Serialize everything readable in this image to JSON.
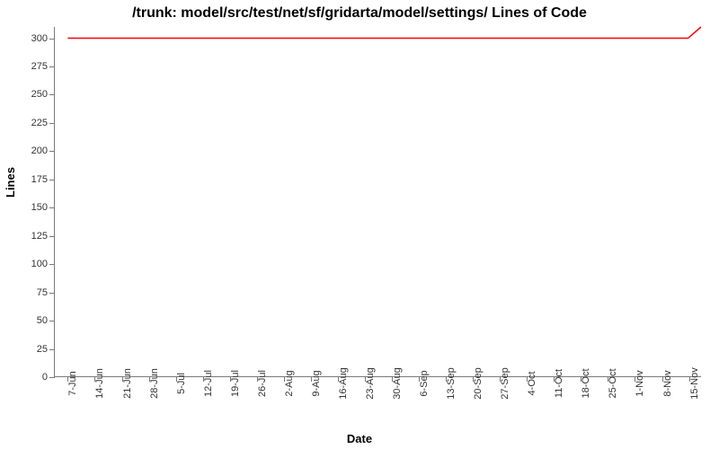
{
  "chart_data": {
    "type": "line",
    "title": "/trunk: model/src/test/net/sf/gridarta/model/settings/ Lines of Code",
    "xlabel": "Date",
    "ylabel": "Lines",
    "ylim": [
      0,
      310
    ],
    "y_ticks": [
      0,
      25,
      50,
      75,
      100,
      125,
      150,
      175,
      200,
      225,
      250,
      275,
      300
    ],
    "x_ticks": [
      "7-Jun",
      "14-Jun",
      "21-Jun",
      "28-Jun",
      "5-Jul",
      "12-Jul",
      "19-Jul",
      "26-Jul",
      "2-Aug",
      "9-Aug",
      "16-Aug",
      "23-Aug",
      "30-Aug",
      "6-Sep",
      "13-Sep",
      "20-Sep",
      "27-Sep",
      "4-Oct",
      "11-Oct",
      "18-Oct",
      "25-Oct",
      "1-Nov",
      "8-Nov",
      "15-Nov"
    ],
    "series": [
      {
        "name": "Lines of Code",
        "color": "#ff0000",
        "points": [
          {
            "x": "7-Jun",
            "y": 300
          },
          {
            "x": "14-Jun",
            "y": 300
          },
          {
            "x": "21-Jun",
            "y": 300
          },
          {
            "x": "28-Jun",
            "y": 300
          },
          {
            "x": "5-Jul",
            "y": 300
          },
          {
            "x": "12-Jul",
            "y": 300
          },
          {
            "x": "19-Jul",
            "y": 300
          },
          {
            "x": "26-Jul",
            "y": 300
          },
          {
            "x": "2-Aug",
            "y": 300
          },
          {
            "x": "9-Aug",
            "y": 300
          },
          {
            "x": "16-Aug",
            "y": 300
          },
          {
            "x": "23-Aug",
            "y": 300
          },
          {
            "x": "30-Aug",
            "y": 300
          },
          {
            "x": "6-Sep",
            "y": 300
          },
          {
            "x": "13-Sep",
            "y": 300
          },
          {
            "x": "20-Sep",
            "y": 300
          },
          {
            "x": "27-Sep",
            "y": 300
          },
          {
            "x": "4-Oct",
            "y": 300
          },
          {
            "x": "11-Oct",
            "y": 300
          },
          {
            "x": "18-Oct",
            "y": 300
          },
          {
            "x": "25-Oct",
            "y": 300
          },
          {
            "x": "1-Nov",
            "y": 300
          },
          {
            "x": "8-Nov",
            "y": 300
          },
          {
            "x": "15-Nov",
            "y": 300
          },
          {
            "x": "18-Nov",
            "y": 310
          }
        ]
      }
    ]
  }
}
